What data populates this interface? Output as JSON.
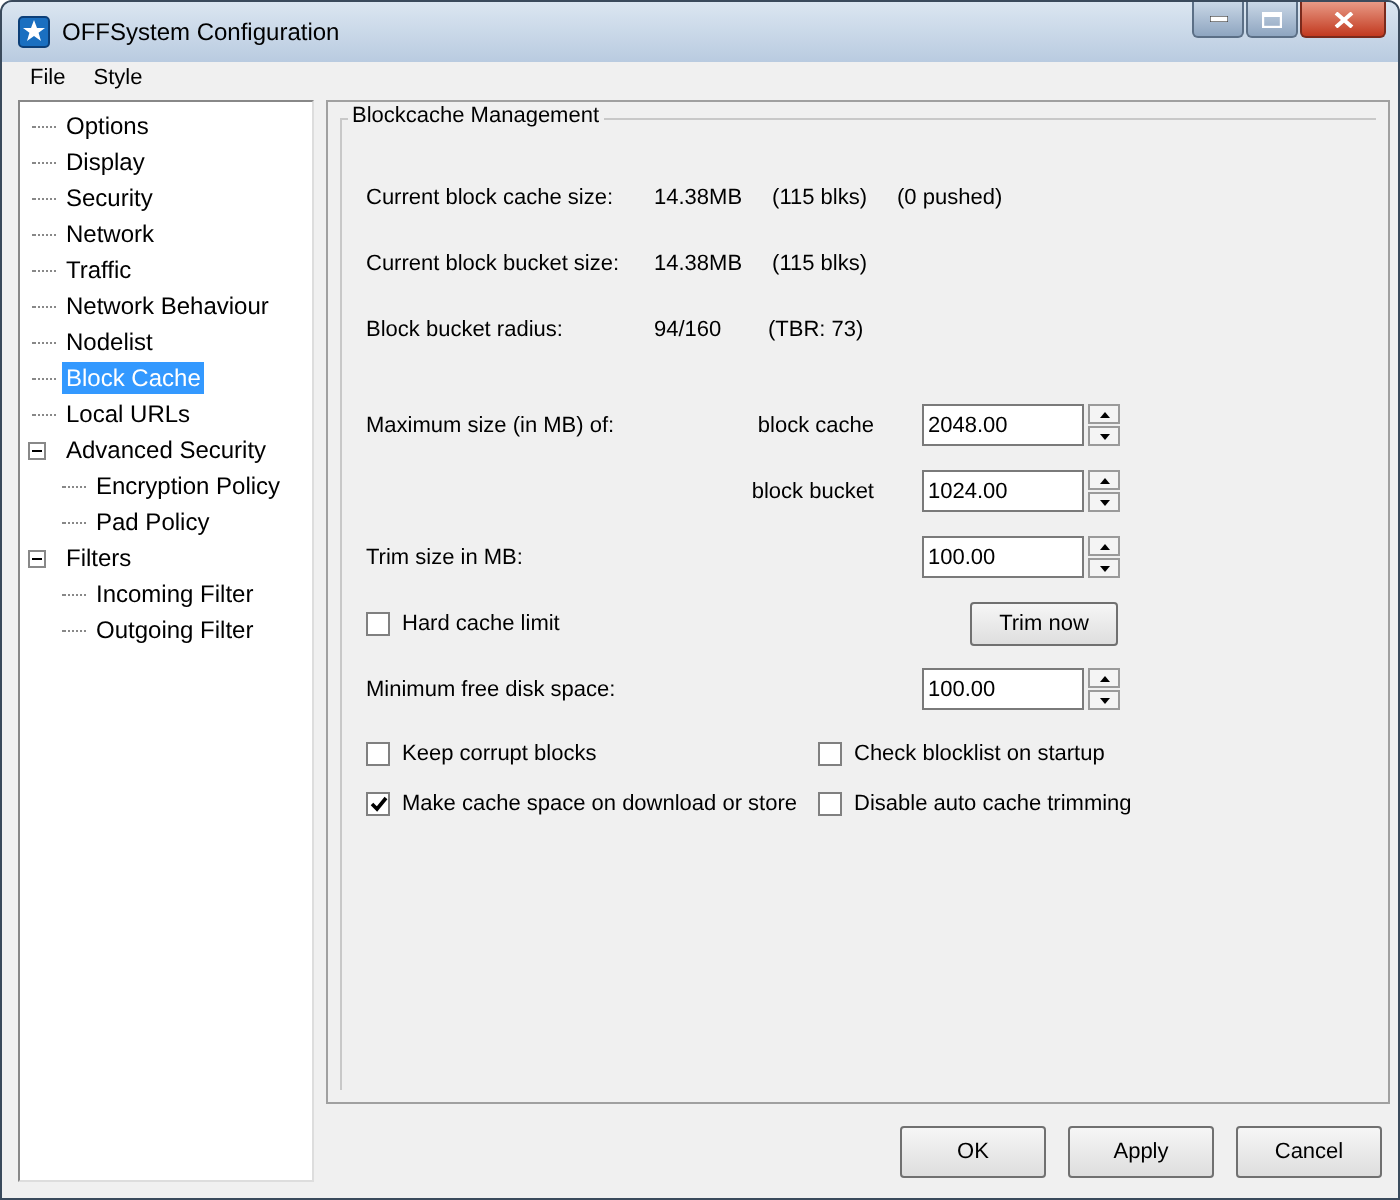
{
  "window": {
    "title": "OFFSystem Configuration"
  },
  "menu": [
    {
      "label": "File"
    },
    {
      "label": "Style"
    }
  ],
  "tree": [
    {
      "label": "Options",
      "selected": false
    },
    {
      "label": "Display",
      "selected": false
    },
    {
      "label": "Security",
      "selected": false
    },
    {
      "label": "Network",
      "selected": false
    },
    {
      "label": "Traffic",
      "selected": false
    },
    {
      "label": "Network Behaviour",
      "selected": false
    },
    {
      "label": "Nodelist",
      "selected": false
    },
    {
      "label": "Block Cache",
      "selected": true
    },
    {
      "label": "Local URLs",
      "selected": false
    },
    {
      "label": "Advanced Security",
      "selected": false,
      "expanded": true,
      "children": [
        {
          "label": "Encryption Policy",
          "selected": false
        },
        {
          "label": "Pad Policy",
          "selected": false
        }
      ]
    },
    {
      "label": "Filters",
      "selected": false,
      "expanded": true,
      "children": [
        {
          "label": "Incoming Filter",
          "selected": false
        },
        {
          "label": "Outgoing Filter",
          "selected": false
        }
      ]
    }
  ],
  "panel": {
    "title": "Blockcache Management",
    "stats": [
      {
        "label": "Current block cache size:",
        "values": [
          "14.38MB",
          "(115 blks)",
          "(0 pushed)"
        ]
      },
      {
        "label": "Current block bucket size:",
        "values": [
          "14.38MB",
          "(115 blks)"
        ]
      },
      {
        "label": "Block bucket radius:",
        "values": [
          "94/160",
          "(TBR: 73)"
        ]
      }
    ],
    "max_size": {
      "label": "Maximum size (in MB) of:",
      "fields": [
        {
          "label": "block cache",
          "value": "2048.00"
        },
        {
          "label": "block bucket",
          "value": "1024.00"
        }
      ]
    },
    "trim": {
      "label": "Trim size in MB:",
      "value": "100.00"
    },
    "hard_cache_limit": {
      "label": "Hard cache limit",
      "checked": false
    },
    "trim_button": "Trim now",
    "min_free": {
      "label": "Minimum free disk space:",
      "value": "100.00"
    },
    "options": [
      {
        "label": "Keep corrupt blocks",
        "checked": false
      },
      {
        "label": "Check blocklist on startup",
        "checked": false
      },
      {
        "label": "Make cache space on download or store",
        "checked": true
      },
      {
        "label": "Disable auto cache trimming",
        "checked": false
      }
    ]
  },
  "buttons": [
    "OK",
    "Apply",
    "Cancel"
  ]
}
